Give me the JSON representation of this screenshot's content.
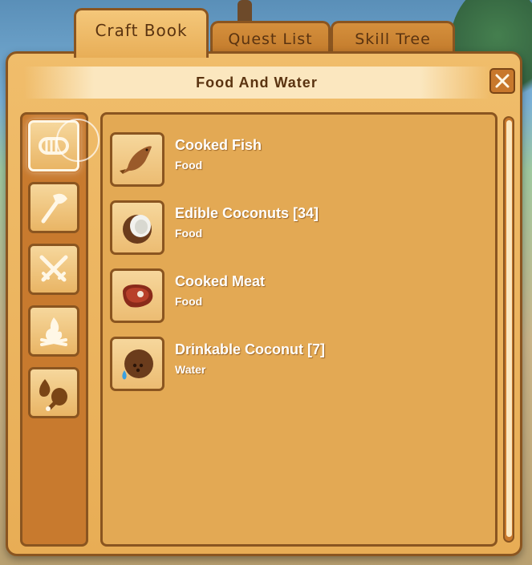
{
  "tabs": [
    {
      "label": "Craft Book",
      "active": true
    },
    {
      "label": "Quest List",
      "active": false
    },
    {
      "label": "Skill Tree",
      "active": false
    }
  ],
  "window": {
    "title": "Food And Water",
    "close_icon": "close-icon"
  },
  "categories": [
    {
      "name": "rope",
      "icon": "rope-icon",
      "selected": true
    },
    {
      "name": "tools",
      "icon": "axe-icon",
      "selected": false
    },
    {
      "name": "weapons",
      "icon": "crossed-swords-icon",
      "selected": false
    },
    {
      "name": "fire",
      "icon": "campfire-icon",
      "selected": false
    },
    {
      "name": "food-and-water",
      "icon": "drumstick-water-icon",
      "selected": false
    }
  ],
  "recipes": [
    {
      "name": "Cooked Fish",
      "category": "Food",
      "icon": "fish-icon"
    },
    {
      "name": "Edible Coconuts [34]",
      "category": "Food",
      "icon": "coconut-half-icon"
    },
    {
      "name": "Cooked Meat",
      "category": "Food",
      "icon": "steak-icon"
    },
    {
      "name": "Drinkable Coconut [7]",
      "category": "Water",
      "icon": "coconut-drink-icon"
    }
  ],
  "colors": {
    "panel": "#e8ad55",
    "border": "#8a5520",
    "sidebar": "#c87a2e",
    "title_text": "#5a3310",
    "item_text": "#ffffff"
  }
}
